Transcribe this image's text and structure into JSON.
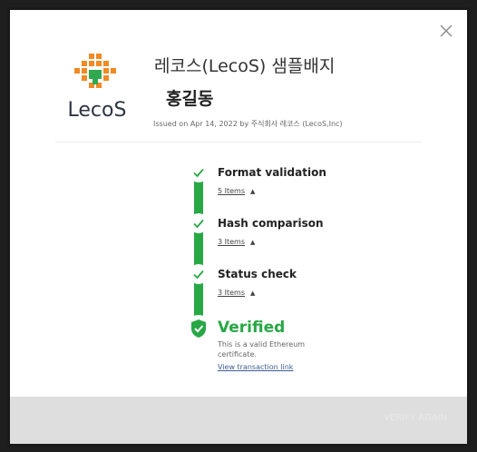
{
  "dialog": {
    "close_label": "×",
    "title": "레코스(LecoS) 샘플배지",
    "recipient": "홍길동",
    "issued": "Issued on Apr 14, 2022 by 주식회사 레코스 (LecoS,Inc)"
  },
  "logo": {
    "wordmark": "LecoS",
    "colors": {
      "orange": "#f08a24",
      "green": "#2fa84f",
      "text": "#2c3440"
    }
  },
  "verification": {
    "steps": [
      {
        "title": "Format validation",
        "items_link": "5 Items",
        "expand_icon": "chevron-up-icon"
      },
      {
        "title": "Hash comparison",
        "items_link": "3 Items",
        "expand_icon": "chevron-up-icon"
      },
      {
        "title": "Status check",
        "items_link": "3 Items",
        "expand_icon": "chevron-up-icon"
      }
    ],
    "result": {
      "label": "Verified",
      "description": "This is a valid Ethereum certificate.",
      "link": "View transaction link"
    },
    "colors": {
      "success": "#27a845",
      "link": "#3d5d96"
    }
  },
  "footer": {
    "button_label": "VERIFY AGAIN"
  }
}
